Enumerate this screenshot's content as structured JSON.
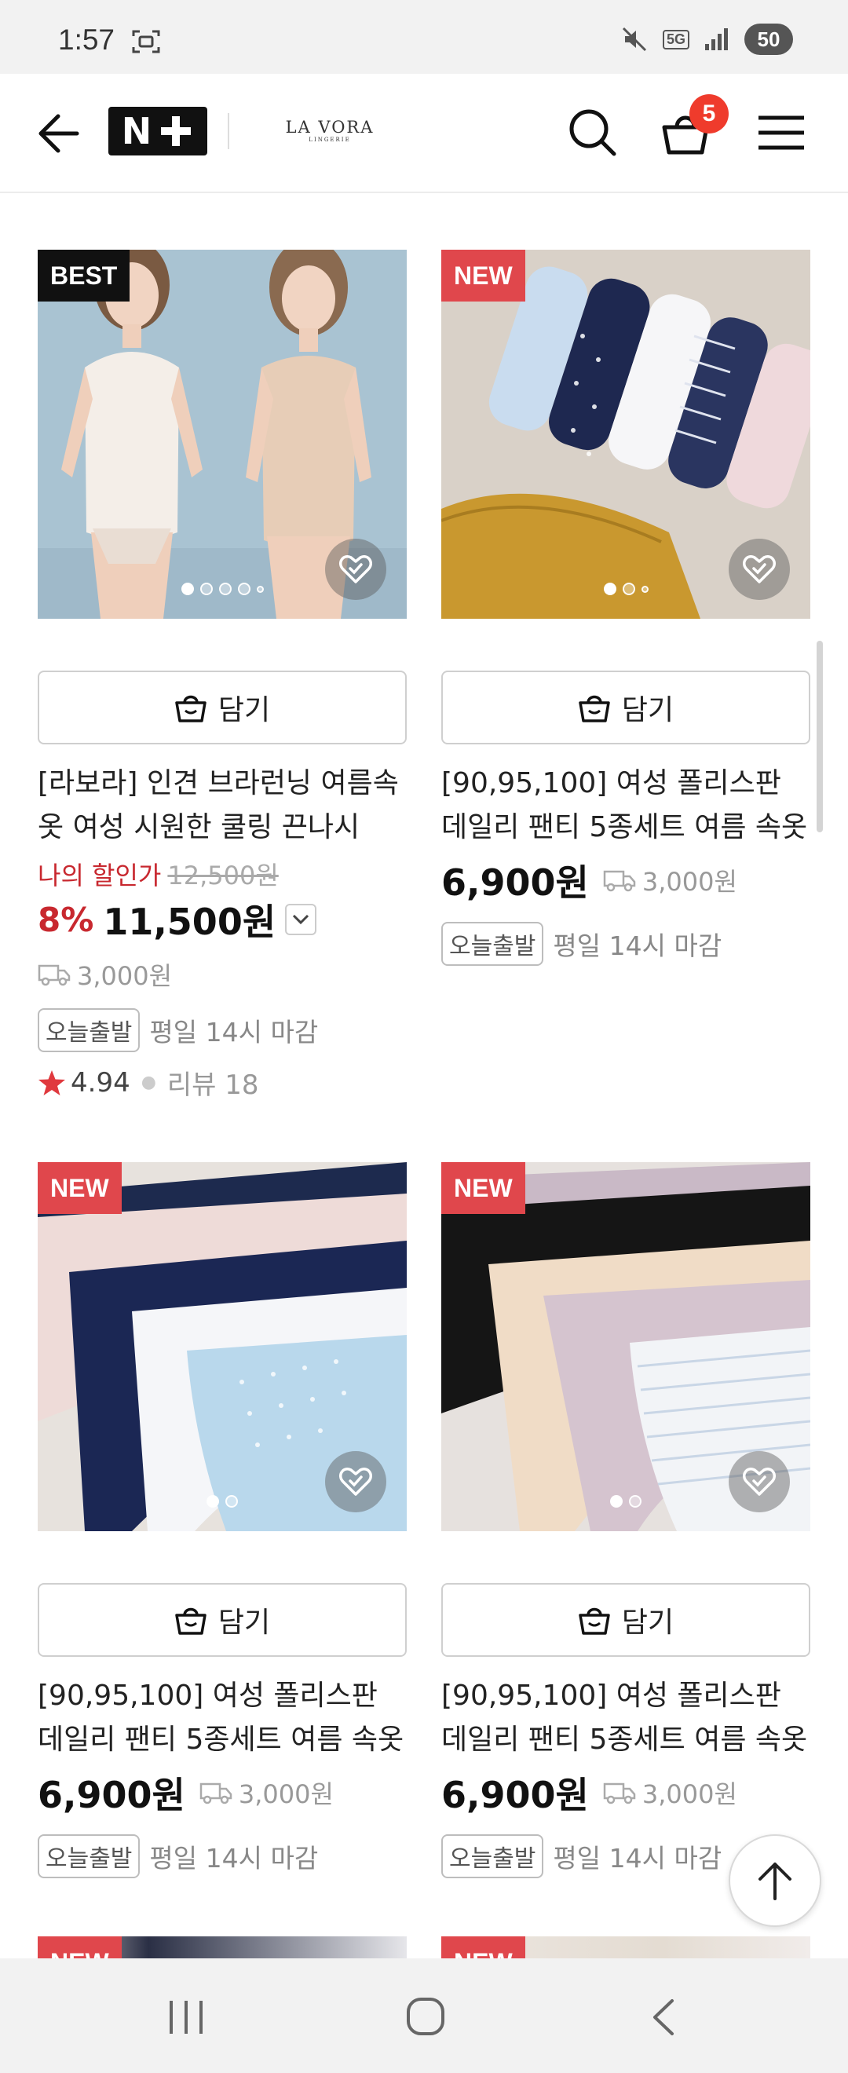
{
  "status_bar": {
    "time": "1:57",
    "network": "5G",
    "battery": "50"
  },
  "header": {
    "brand_line1": "LA VORA",
    "brand_line2": "LINGERIE",
    "cart_count": "5"
  },
  "add_to_cart_label": "담기",
  "products": [
    {
      "badge": "BEST",
      "title": "[라보라] 인견 브라런닝 여름속옷 여성 시원한 쿨링 끈나시",
      "discount_label": "나의 할인가",
      "original_price": "12,500원",
      "discount_percent": "8%",
      "price": "11,500원",
      "shipping": "3,000원",
      "same_day_label": "오늘출발",
      "deadline": "평일 14시 마감",
      "rating": "4.94",
      "review_label": "리뷰 18",
      "image_count": 5,
      "active_image": 1
    },
    {
      "badge": "NEW",
      "title": "[90,95,100] 여성 폴리스판 데일리 팬티 5종세트 여름 속옷",
      "price": "6,900원",
      "shipping": "3,000원",
      "same_day_label": "오늘출발",
      "deadline": "평일 14시 마감",
      "image_count": 3,
      "active_image": 1
    },
    {
      "badge": "NEW",
      "title": "[90,95,100] 여성 폴리스판 데일리 팬티 5종세트 여름 속옷",
      "price": "6,900원",
      "shipping": "3,000원",
      "same_day_label": "오늘출발",
      "deadline": "평일 14시 마감",
      "image_count": 2,
      "active_image": 1
    },
    {
      "badge": "NEW",
      "title": "[90,95,100] 여성 폴리스판 데일리 팬티 5종세트 여름 속옷",
      "price": "6,900원",
      "shipping": "3,000원",
      "same_day_label": "오늘출발",
      "deadline": "평일 14시 마감",
      "image_count": 2,
      "active_image": 1
    }
  ],
  "peek_badges": [
    "NEW",
    "NEW"
  ],
  "colors": {
    "badge_new": "#e0474c",
    "badge_best": "#111111",
    "discount": "#c8282f",
    "cart_badge": "#ef3b2c"
  }
}
